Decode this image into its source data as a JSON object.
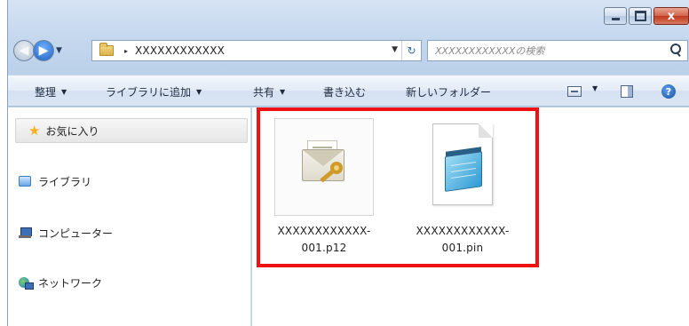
{
  "window": {
    "caption_buttons": {
      "close_label": "x"
    }
  },
  "address_bar": {
    "path": "XXXXXXXXXXXX",
    "separator": "▸",
    "refresh_glyph": "↻"
  },
  "search": {
    "placeholder": "XXXXXXXXXXXXの検索"
  },
  "command_bar": {
    "organize": "整理",
    "add_to_library": "ライブラリに追加",
    "share": "共有",
    "burn": "書き込む",
    "new_folder": "新しいフォルダー",
    "caret": "▼",
    "help": "?"
  },
  "nav_pane": {
    "favorites": "お気に入り",
    "libraries": "ライブラリ",
    "computer": "コンピューター",
    "network": "ネットワーク"
  },
  "files": [
    {
      "name_line1": "XXXXXXXXXXXX-",
      "name_line2": "001.p12",
      "icon": "certificate-icon"
    },
    {
      "name_line1": "XXXXXXXXXXXX-",
      "name_line2": "001.pin",
      "icon": "notepad-document-icon"
    }
  ],
  "colors": {
    "highlight_border": "#ef1111",
    "frame_accent": "#bcd1ea",
    "close_button": "#c0391e"
  }
}
